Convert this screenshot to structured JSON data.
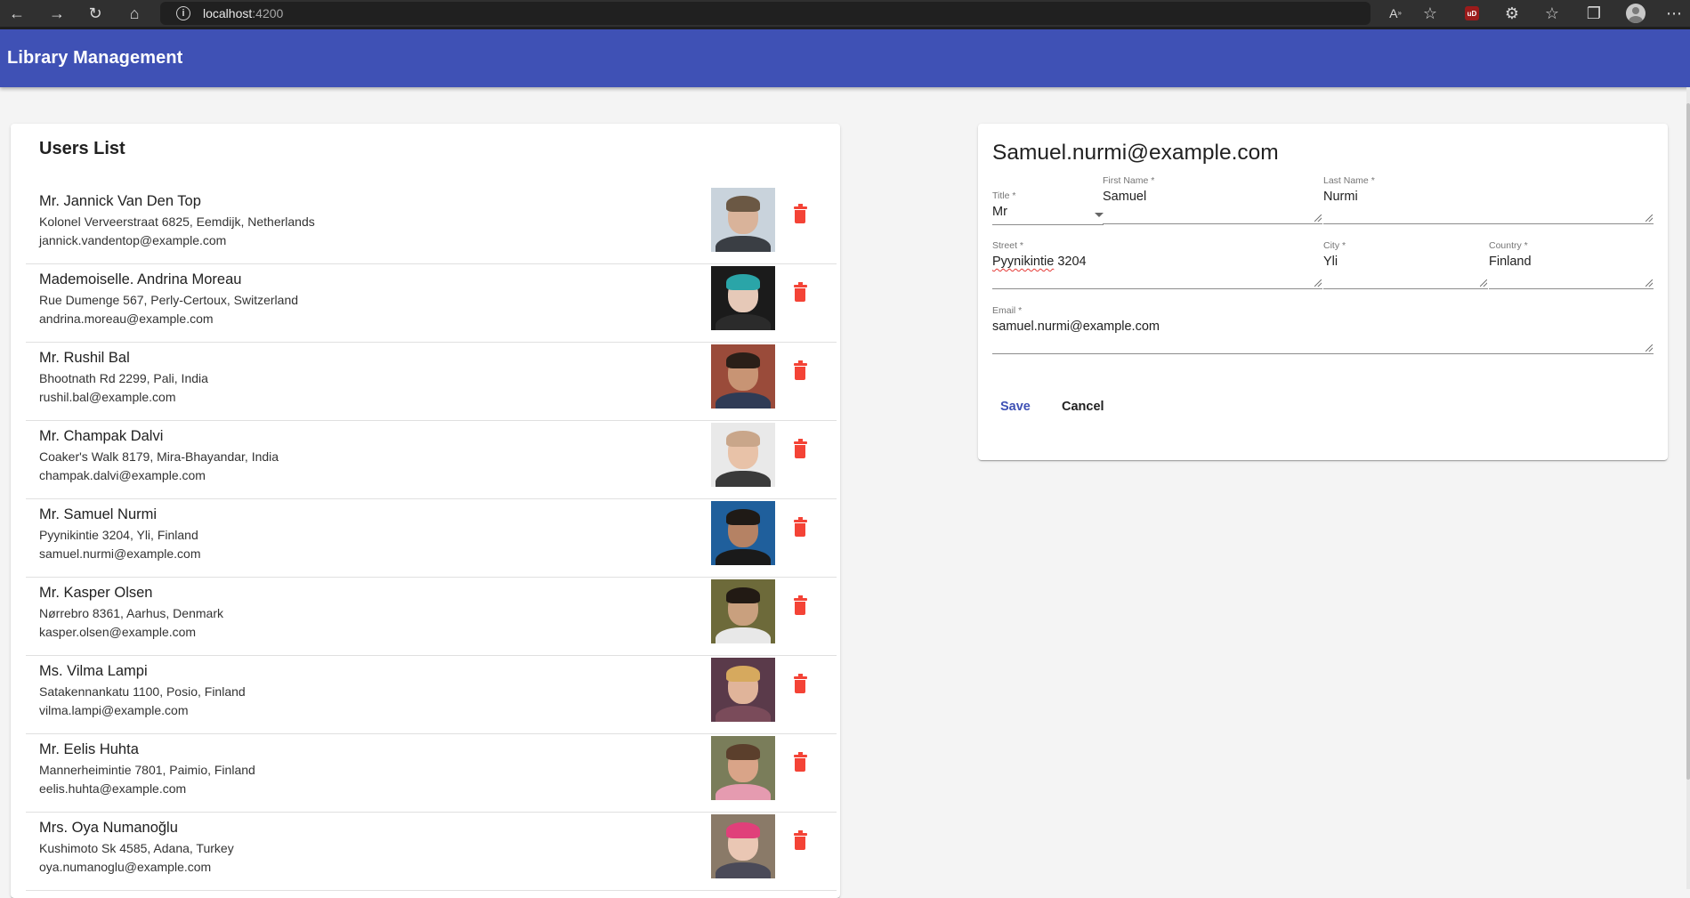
{
  "browser": {
    "url_host": "localhost",
    "url_port": ":4200",
    "ublock_badge": "uD"
  },
  "app": {
    "title": "Library Management"
  },
  "users_list": {
    "title": "Users List",
    "users": [
      {
        "name": "Mr. Jannick Van Den Top",
        "address": "Kolonel Verveerstraat 6825, Eemdijk, Netherlands",
        "email": "jannick.vandentop@example.com",
        "bg": "#c9d3dc",
        "skin": "#d9b39a",
        "hair": "#6b5844",
        "shirt": "#3a3e44"
      },
      {
        "name": "Mademoiselle. Andrina Moreau",
        "address": "Rue Dumenge 567, Perly-Certoux, Switzerland",
        "email": "andrina.moreau@example.com",
        "bg": "#1b1b1b",
        "skin": "#e6c9b8",
        "hair": "#2aa5a8",
        "shirt": "#2b2b2b"
      },
      {
        "name": "Mr. Rushil Bal",
        "address": "Bhootnath Rd 2299, Pali, India",
        "email": "rushil.bal@example.com",
        "bg": "#9a4b3a",
        "skin": "#c89474",
        "hair": "#2a1f18",
        "shirt": "#2f3b55"
      },
      {
        "name": "Mr. Champak Dalvi",
        "address": "Coaker's Walk 8179, Mira-Bhayandar, India",
        "email": "champak.dalvi@example.com",
        "bg": "#e9e9e9",
        "skin": "#e8c2a8",
        "hair": "#c9a68a",
        "shirt": "#3a3a3a"
      },
      {
        "name": "Mr. Samuel Nurmi",
        "address": "Pyynikintie 3204, Yli, Finland",
        "email": "samuel.nurmi@example.com",
        "bg": "#1f5f9c",
        "skin": "#b58264",
        "hair": "#1f1a16",
        "shirt": "#1a1a1a"
      },
      {
        "name": "Mr. Kasper Olsen",
        "address": "Nørrebro 8361, Aarhus, Denmark",
        "email": "kasper.olsen@example.com",
        "bg": "#6d6a3a",
        "skin": "#c9a07e",
        "hair": "#221a14",
        "shirt": "#e8e8e8"
      },
      {
        "name": "Ms. Vilma Lampi",
        "address": "Satakennankatu 1100, Posio, Finland",
        "email": "vilma.lampi@example.com",
        "bg": "#5a3a4a",
        "skin": "#e0b49a",
        "hair": "#d6a95e",
        "shirt": "#7a4b5a"
      },
      {
        "name": "Mr. Eelis Huhta",
        "address": "Mannerheimintie 7801, Paimio, Finland",
        "email": "eelis.huhta@example.com",
        "bg": "#7a7d5a",
        "skin": "#d9a488",
        "hair": "#5b3f2c",
        "shirt": "#e59bb0"
      },
      {
        "name": "Mrs. Oya Numanoğlu",
        "address": "Kushimoto Sk 4585, Adana, Turkey",
        "email": "oya.numanoglu@example.com",
        "bg": "#8a7a68",
        "skin": "#eac7b4",
        "hair": "#e0407a",
        "shirt": "#4a4a58"
      }
    ]
  },
  "edit_form": {
    "title": "Samuel.nurmi@example.com",
    "fields": {
      "title_label": "Title *",
      "title_value": "Mr",
      "first_name_label": "First Name *",
      "first_name_value": "Samuel",
      "last_name_label": "Last Name *",
      "last_name_value": "Nurmi",
      "street_label": "Street *",
      "street_value_misspelled": "Pyynikintie",
      "street_value_rest": " 3204",
      "city_label": "City *",
      "city_value": "Yli",
      "country_label": "Country *",
      "country_value": "Finland",
      "email_label": "Email *",
      "email_value": "samuel.nurmi@example.com"
    },
    "save_label": "Save",
    "cancel_label": "Cancel"
  },
  "colors": {
    "primary": "#3f51b5",
    "delete": "#f44336",
    "background": "#f4f4f4"
  }
}
